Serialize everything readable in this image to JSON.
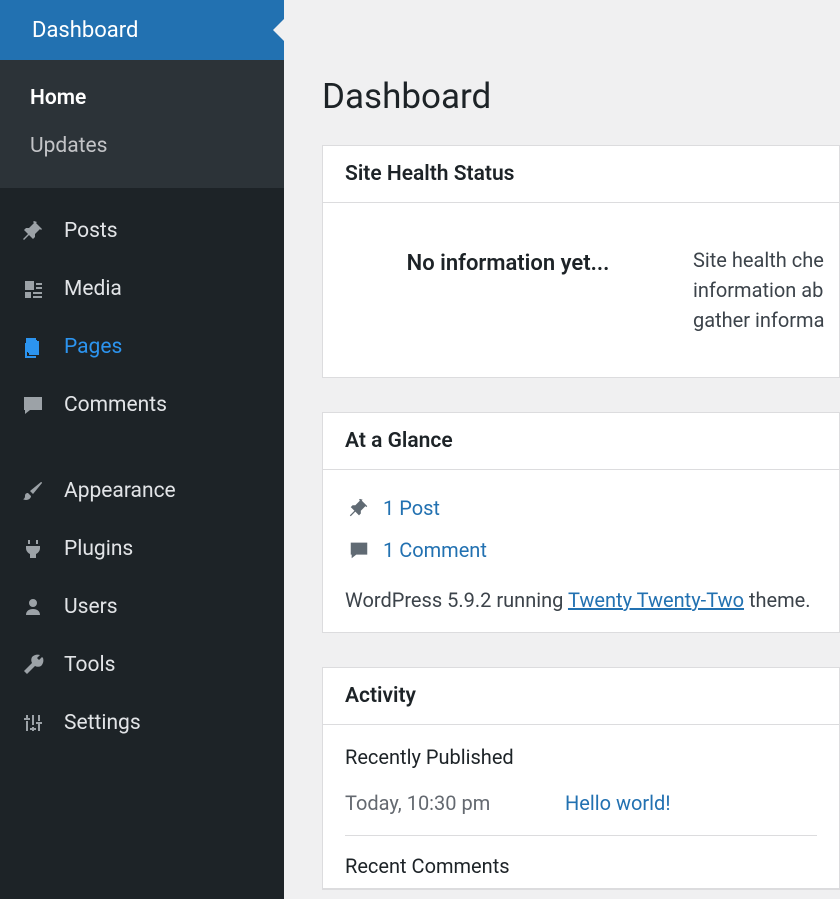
{
  "sidebar": {
    "top": {
      "label": "Dashboard"
    },
    "submenu": [
      {
        "label": "Home",
        "current": true
      },
      {
        "label": "Updates",
        "current": false
      }
    ],
    "items": [
      {
        "key": "posts",
        "label": "Posts"
      },
      {
        "key": "media",
        "label": "Media"
      },
      {
        "key": "pages",
        "label": "Pages",
        "active": true
      },
      {
        "key": "comments",
        "label": "Comments"
      },
      {
        "key": "appearance",
        "label": "Appearance"
      },
      {
        "key": "plugins",
        "label": "Plugins"
      },
      {
        "key": "users",
        "label": "Users"
      },
      {
        "key": "tools",
        "label": "Tools"
      },
      {
        "key": "settings",
        "label": "Settings"
      }
    ]
  },
  "page": {
    "title": "Dashboard"
  },
  "siteHealth": {
    "heading": "Site Health Status",
    "status": "No information yet...",
    "desc1": "Site health che",
    "desc2": "information ab",
    "desc3": "gather informa"
  },
  "glance": {
    "heading": "At a Glance",
    "posts": "1 Post",
    "comments": "1 Comment",
    "footer_pre": "WordPress 5.9.2 running ",
    "footer_theme": "Twenty Twenty-Two",
    "footer_post": " theme."
  },
  "activity": {
    "heading": "Activity",
    "sub1": "Recently Published",
    "time": "Today, 10:30 pm",
    "link": "Hello world!",
    "sub2": "Recent Comments"
  }
}
